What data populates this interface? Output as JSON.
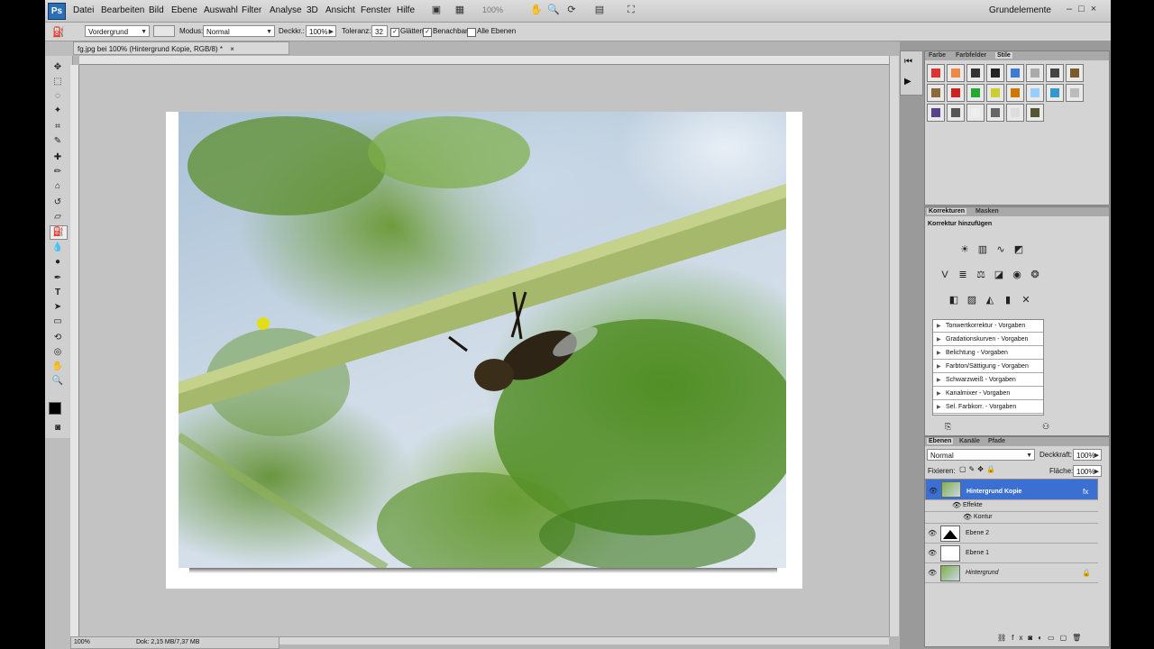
{
  "app": {
    "logo": "Ps",
    "menu": [
      "Datei",
      "Bearbeiten",
      "Bild",
      "Ebene",
      "Auswahl",
      "Filter",
      "Analyse",
      "3D",
      "Ansicht",
      "Fenster",
      "Hilfe"
    ],
    "zoom": "100%",
    "workspace": "Grundelemente",
    "window_controls": "–□×"
  },
  "options": {
    "fill_source": "Vordergrund",
    "mode_label": "Modus:",
    "mode_value": "Normal",
    "opacity_label": "Deckkr.:",
    "opacity_value": "100%",
    "tolerance_label": "Toleranz:",
    "tolerance_value": "32",
    "smooth_label": "Glätten",
    "contiguous_label": "Benachbart",
    "all_layers_label": "Alle Ebenen"
  },
  "document": {
    "tab_title": "fg.jpg bei 100% (Hintergrund Kopie, RGB/8) *",
    "tab_close": "×",
    "status_zoom": "100%",
    "status_doc": "Dok: 2,15 MB/7,37 MB"
  },
  "panels": {
    "top_tabs": [
      "Farbe",
      "Farbfelder",
      "Stile"
    ],
    "adjust_tabs": [
      "Korrekturen",
      "Masken"
    ],
    "adjust_title": "Korrektur hinzufügen",
    "presets": [
      "Tonwertkorrektur - Vorgaben",
      "Gradationskurven - Vorgaben",
      "Belichtung - Vorgaben",
      "Farbton/Sättigung - Vorgaben",
      "Schwarzweiß - Vorgaben",
      "Kanalmixer - Vorgaben",
      "Sel. Farbkorr. - Vorgaben"
    ],
    "layers_tabs": [
      "Ebenen",
      "Kanäle",
      "Pfade"
    ],
    "blend_mode": "Normal",
    "opacity_label": "Deckkraft:",
    "opacity_value": "100%",
    "lock_label": "Fixieren:",
    "fill_label": "Fläche:",
    "fill_value": "100%",
    "layers": [
      {
        "name": "Hintergrund Kopie",
        "selected": true
      },
      {
        "name": "Effekte",
        "sub": true
      },
      {
        "name": "Kontur",
        "sub": true
      },
      {
        "name": "Ebene 2"
      },
      {
        "name": "Ebene 1"
      },
      {
        "name": "Hintergrund",
        "locked": true
      }
    ]
  },
  "colors": {
    "accent": "#3b6fd1",
    "ps_blue": "#2a6fb5"
  }
}
